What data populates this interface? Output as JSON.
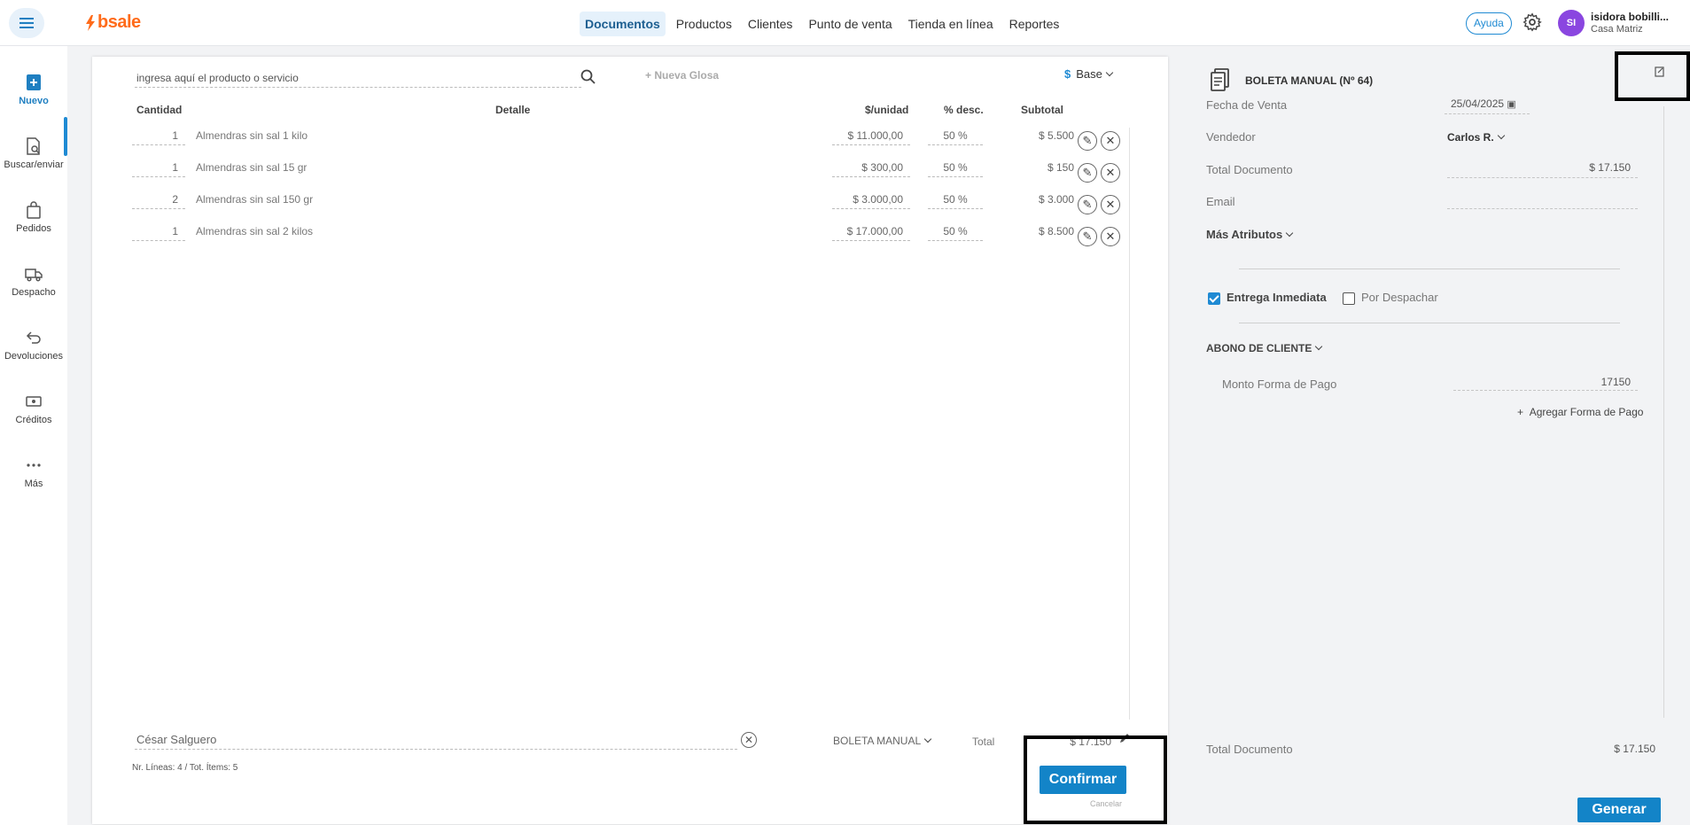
{
  "topbar": {
    "brand": "bsale",
    "nav": [
      "Documentos",
      "Productos",
      "Clientes",
      "Punto de venta",
      "Tienda en línea",
      "Reportes"
    ],
    "active_nav": "Documentos",
    "help_label": "Ayuda",
    "avatar_initials": "SI",
    "user_name": "isidora bobilli...",
    "user_branch": "Casa Matriz"
  },
  "sidebar": {
    "items": [
      {
        "label": "Nuevo",
        "icon": "new-document-icon"
      },
      {
        "label": "Buscar/enviar",
        "icon": "search-document-icon"
      },
      {
        "label": "Pedidos",
        "icon": "shopping-bag-icon"
      },
      {
        "label": "Despacho",
        "icon": "truck-icon"
      },
      {
        "label": "Devoluciones",
        "icon": "return-arrow-icon"
      },
      {
        "label": "Créditos",
        "icon": "credit-icon"
      },
      {
        "label": "Más",
        "icon": "more-dots-icon"
      }
    ]
  },
  "document": {
    "search_placeholder": "ingresa aquí el producto o servicio",
    "new_glosa_label": "Nueva Glosa",
    "price_list": {
      "symbol": "$",
      "label": "Base"
    },
    "columns": {
      "qty": "Cantidad",
      "detail": "Detalle",
      "unit_price": "$/unidad",
      "discount": "% desc.",
      "subtotal": "Subtotal"
    },
    "rows": [
      {
        "qty": "1",
        "detail": "Almendras sin sal 1 kilo",
        "unit_price": "$ 11.000,00",
        "discount": "50 %",
        "subtotal": "$ 5.500"
      },
      {
        "qty": "1",
        "detail": "Almendras sin sal 15 gr",
        "unit_price": "$ 300,00",
        "discount": "50 %",
        "subtotal": "$ 150"
      },
      {
        "qty": "2",
        "detail": "Almendras sin sal 150 gr",
        "unit_price": "$ 3.000,00",
        "discount": "50 %",
        "subtotal": "$ 3.000"
      },
      {
        "qty": "1",
        "detail": "Almendras sin sal 2 kilos",
        "unit_price": "$ 17.000,00",
        "discount": "50 %",
        "subtotal": "$ 8.500"
      }
    ],
    "customer": "César Salguero",
    "document_type": "BOLETA MANUAL",
    "total_label": "Total",
    "total_value": "$ 17.150",
    "lines_info": "Nr. Líneas: 4 / Tot. Ítems: 5",
    "confirm_label": "Confirmar",
    "cancel_label": "Cancelar"
  },
  "panel": {
    "title": "BOLETA MANUAL (Nº 64)",
    "fecha_label": "Fecha de Venta",
    "fecha_value": "25/04/2025",
    "vendedor_label": "Vendedor",
    "vendedor_value": "Carlos R.",
    "total_doc_label": "Total Documento",
    "total_doc_value": "$ 17.150",
    "email_label": "Email",
    "mas_atributos": "Más Atributos",
    "entrega_inmediata": "Entrega Inmediata",
    "entrega_checked": true,
    "por_despachar": "Por Despachar",
    "abono_label": "ABONO DE CLIENTE",
    "monto_label": "Monto Forma de Pago",
    "monto_value": "17150",
    "agregar_label": "Agregar Forma de Pago",
    "footer_total_label": "Total Documento",
    "footer_total_value": "$ 17.150",
    "generar_label": "Generar"
  },
  "colors": {
    "accent": "#1384c8",
    "brand": "#ff6b1a",
    "avatar": "#8a46e0"
  }
}
